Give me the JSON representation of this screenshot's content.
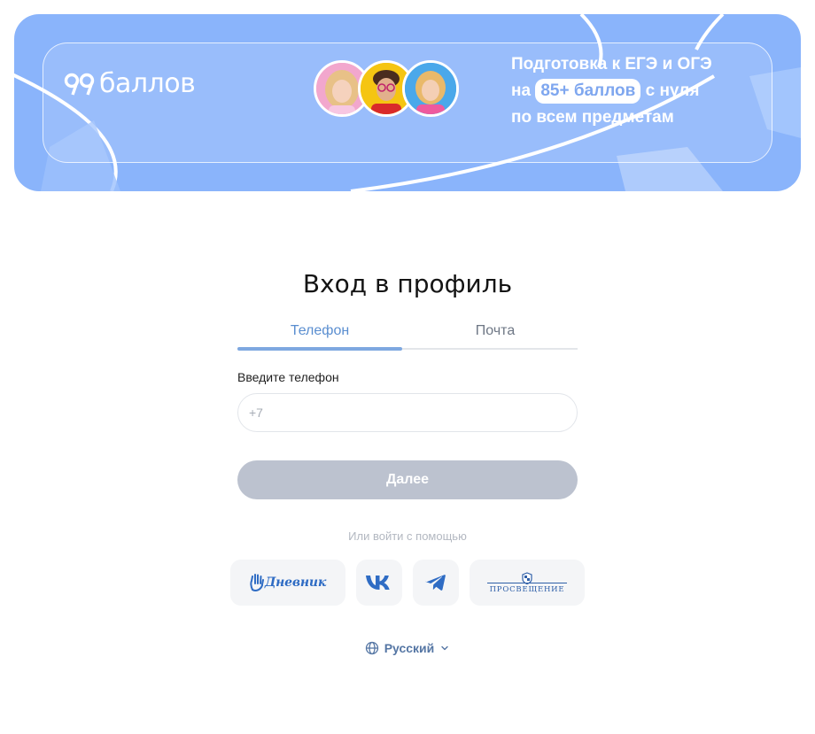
{
  "banner": {
    "logo_number": "99",
    "logo_word": "баллов",
    "promo_line1": "Подготовка к ЕГЭ и ОГЭ",
    "promo_line2_prefix": "на",
    "promo_highlight": "85+ баллов",
    "promo_line2_suffix": "с нуля",
    "promo_line3": "по всем предметам"
  },
  "form": {
    "title": "Вход в профиль",
    "tabs": [
      {
        "label": "Телефон",
        "active": true
      },
      {
        "label": "Почта",
        "active": false
      }
    ],
    "phone_label": "Введите телефон",
    "phone_placeholder": "+7",
    "phone_value": "",
    "next_button": "Далее",
    "alt_login_label": "Или войти с помощью"
  },
  "social": {
    "dnevnik_label": "Дневник",
    "prosveshchenie_label": "ПРОСВЕЩЕНИЕ"
  },
  "language": {
    "selected": "Русский"
  },
  "colors": {
    "banner_bg": "#8ab4fb",
    "accent": "#7ea8e0",
    "tab_active_text": "#5a8ed0",
    "button_disabled": "#bcc2cf",
    "social_bg": "#f4f5f7",
    "vk_blue": "#2f6cc4"
  }
}
